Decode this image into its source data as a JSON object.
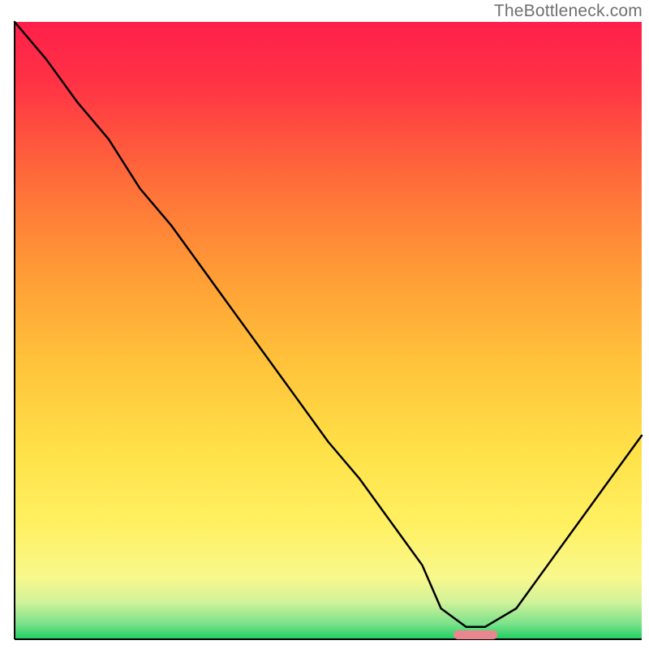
{
  "watermark": "TheBottleneck.com",
  "chart_data": {
    "type": "line",
    "title": "",
    "xlabel": "",
    "ylabel": "",
    "x": [
      0,
      5,
      10,
      15,
      20,
      25,
      30,
      35,
      40,
      45,
      50,
      55,
      60,
      65,
      68,
      72,
      75,
      80,
      85,
      90,
      95,
      100
    ],
    "values": [
      100,
      94,
      87,
      81,
      73,
      67,
      60,
      53,
      46,
      39,
      32,
      26,
      19,
      12,
      5,
      2,
      2,
      5,
      12,
      19,
      26,
      33
    ],
    "xlim": [
      0,
      100
    ],
    "ylim": [
      0,
      100
    ],
    "background": {
      "type": "vertical-gradient",
      "stops": [
        {
          "offset": 0.0,
          "color": "#ff1f4a"
        },
        {
          "offset": 0.1,
          "color": "#ff3345"
        },
        {
          "offset": 0.25,
          "color": "#ff6a3a"
        },
        {
          "offset": 0.4,
          "color": "#ff9a36"
        },
        {
          "offset": 0.55,
          "color": "#ffc23a"
        },
        {
          "offset": 0.7,
          "color": "#ffe249"
        },
        {
          "offset": 0.82,
          "color": "#fff164"
        },
        {
          "offset": 0.9,
          "color": "#f8f88c"
        },
        {
          "offset": 0.94,
          "color": "#d1f29a"
        },
        {
          "offset": 0.975,
          "color": "#7be28b"
        },
        {
          "offset": 1.0,
          "color": "#1ecf63"
        }
      ]
    },
    "marker_band": {
      "x_from": 70,
      "x_to": 77,
      "color": "#e9868f"
    }
  },
  "plot": {
    "margin_left": 18,
    "margin_right": 9,
    "margin_top": 27,
    "margin_bottom": 12
  }
}
